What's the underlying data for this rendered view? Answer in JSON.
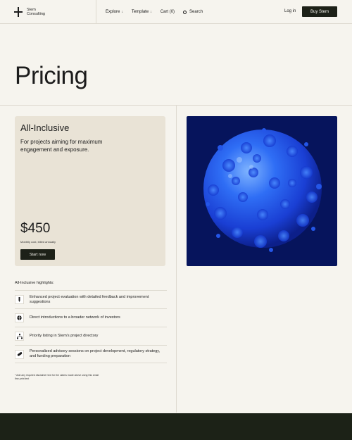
{
  "brand": {
    "name_line1": "Stem",
    "name_line2": "Consulting"
  },
  "nav": {
    "explore": "Explore",
    "template": "Template",
    "cart": "Cart (0)",
    "search": "Search",
    "login": "Log in",
    "buy": "Buy Stem"
  },
  "page": {
    "title": "Pricing"
  },
  "plan": {
    "name": "All-Inclusive",
    "description": "For projects aiming for maximum engagement and exposure.",
    "price": "$450",
    "billing": "Monthly cost, billed annually",
    "cta": "Start now"
  },
  "highlights": {
    "heading": "All-Inclusive highlights:",
    "items": [
      {
        "icon": "pen-icon",
        "text": "Enhanced project evaluation with detailed feedback and improvement suggestions"
      },
      {
        "icon": "globe-icon",
        "text": "Direct introductions to a broader network of investors"
      },
      {
        "icon": "network-icon",
        "text": "Priority listing in Stem's project directory"
      },
      {
        "icon": "pill-icon",
        "text": "Personalized advisory sessions on project development, regulatory strategy, and funding preparation"
      }
    ]
  },
  "footnote": "* Add any required disclaimer text for the claims made above using this small fine-print text",
  "colors": {
    "background": "#f6f4ee",
    "card": "#e9e3d6",
    "dark": "#1d2118",
    "image_bg": "#06145c",
    "accent_blue": "#2a6cf0"
  }
}
